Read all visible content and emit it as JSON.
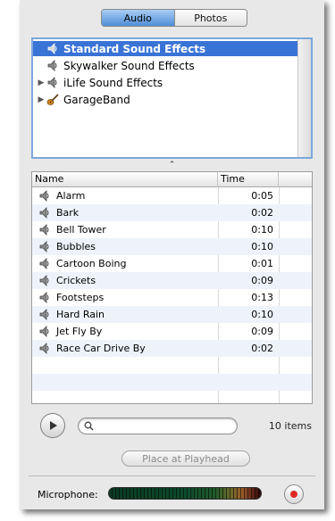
{
  "tabs": [
    {
      "label": "Audio",
      "active": true
    },
    {
      "label": "Photos",
      "active": false
    }
  ],
  "sources": [
    {
      "label": "Standard Sound Effects",
      "icon": "speaker-icon",
      "selected": true,
      "disclosure": ""
    },
    {
      "label": "Skywalker Sound Effects",
      "icon": "speaker-icon",
      "selected": false,
      "disclosure": ""
    },
    {
      "label": "iLife Sound Effects",
      "icon": "speaker-icon",
      "selected": false,
      "disclosure": "▶"
    },
    {
      "label": "GarageBand",
      "icon": "guitar-icon",
      "selected": false,
      "disclosure": "▶"
    }
  ],
  "table": {
    "columns": {
      "name": "Name",
      "time": "Time"
    },
    "rows": [
      {
        "name": "Alarm",
        "time": "0:05"
      },
      {
        "name": "Bark",
        "time": "0:02"
      },
      {
        "name": "Bell Tower",
        "time": "0:10"
      },
      {
        "name": "Bubbles",
        "time": "0:10"
      },
      {
        "name": "Cartoon Boing",
        "time": "0:01"
      },
      {
        "name": "Crickets",
        "time": "0:09"
      },
      {
        "name": "Footsteps",
        "time": "0:13"
      },
      {
        "name": "Hard Rain",
        "time": "0:10"
      },
      {
        "name": "Jet Fly By",
        "time": "0:09"
      },
      {
        "name": "Race Car Drive By",
        "time": "0:02"
      }
    ]
  },
  "search": {
    "value": "",
    "placeholder": ""
  },
  "item_count": "10 items",
  "place_button": "Place at Playhead",
  "microphone_label": "Microphone:",
  "colors": {
    "selection": "#3a73d6",
    "record": "#e02a24",
    "row_stripe": "#eef3fb"
  }
}
